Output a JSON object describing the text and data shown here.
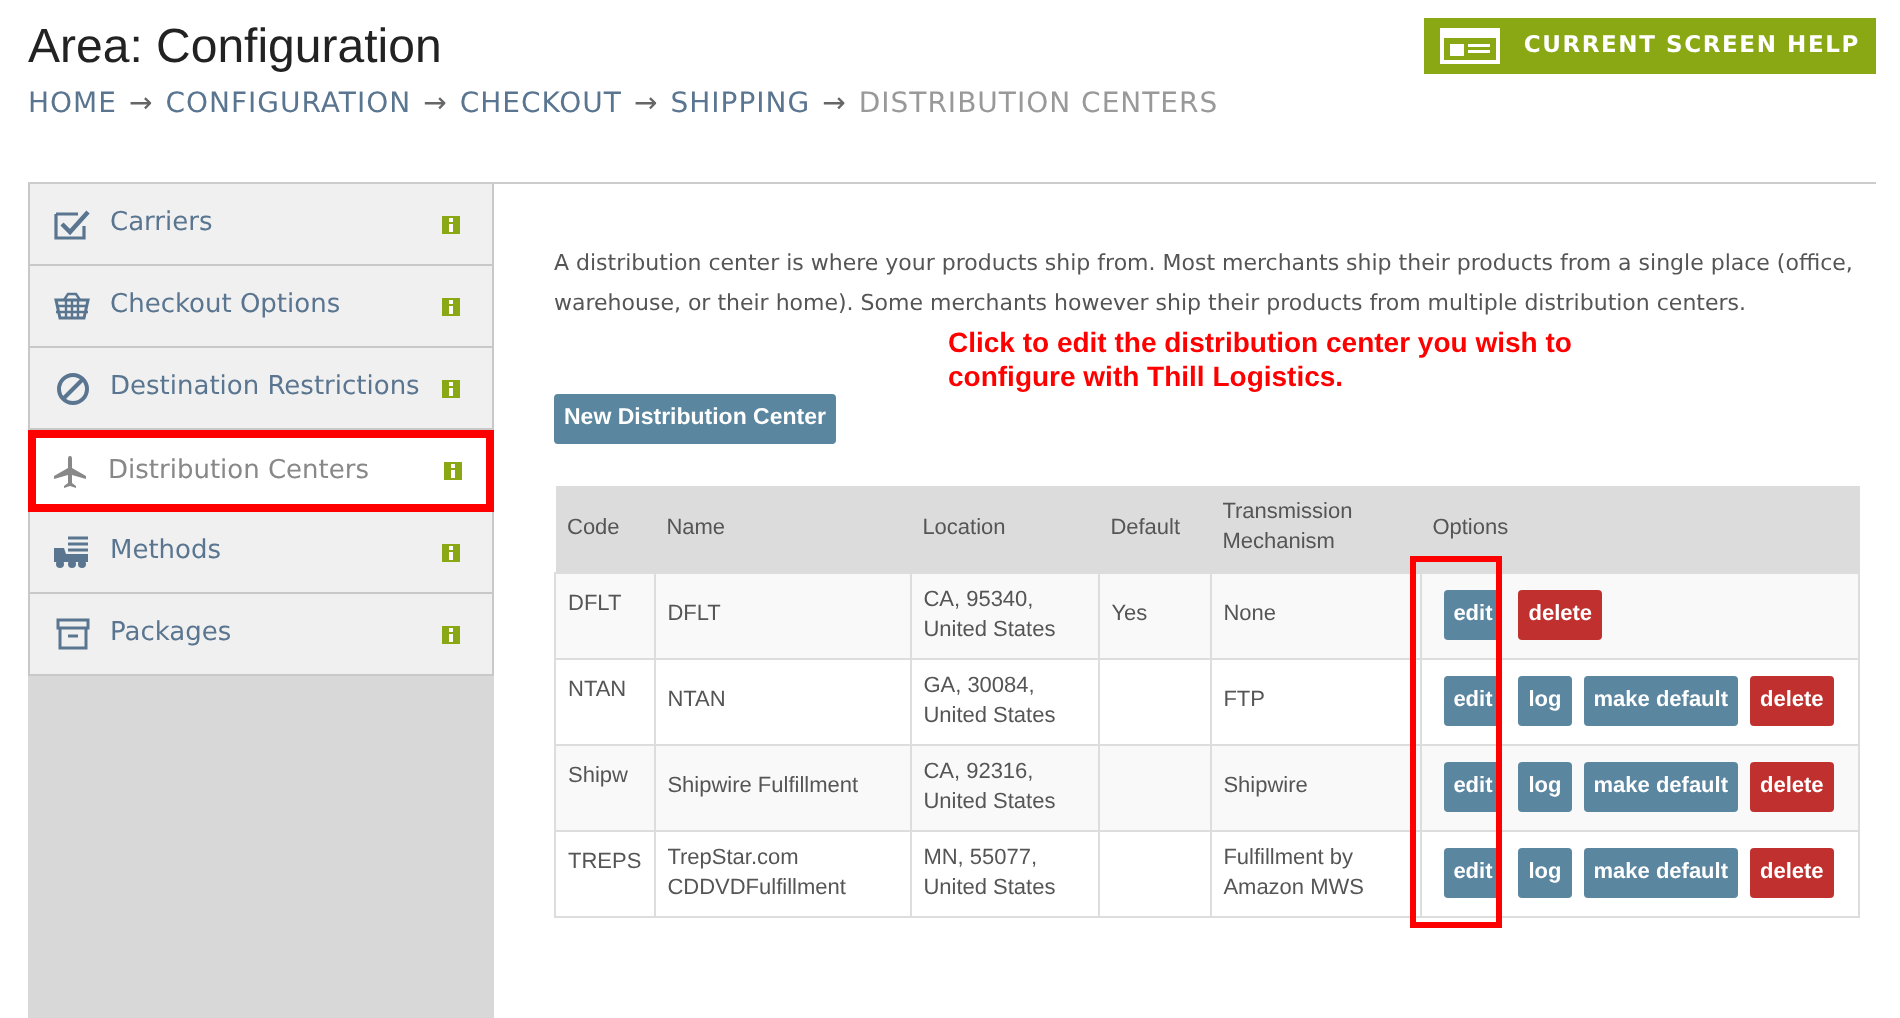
{
  "header": {
    "title": "Area: Configuration",
    "help_button": "CURRENT SCREEN HELP",
    "breadcrumb": [
      {
        "label": "HOME",
        "current": false
      },
      {
        "label": "CONFIGURATION",
        "current": false
      },
      {
        "label": "CHECKOUT",
        "current": false
      },
      {
        "label": "SHIPPING",
        "current": false
      },
      {
        "label": "DISTRIBUTION CENTERS",
        "current": true
      }
    ],
    "separator": "→"
  },
  "sidebar": {
    "items": [
      {
        "label": "Carriers",
        "selected": false
      },
      {
        "label": "Checkout Options",
        "selected": false
      },
      {
        "label": "Destination Restrictions",
        "selected": false
      },
      {
        "label": "Distribution Centers",
        "selected": true
      },
      {
        "label": "Methods",
        "selected": false
      },
      {
        "label": "Packages",
        "selected": false
      }
    ]
  },
  "intro": "A distribution center is where your products ship from. Most merchants ship their products from a single place (office, warehouse, or their home). Some merchants however ship their products from multiple distribution centers.",
  "annotation": "Click to edit the distribution center you wish to configure with Thill Logistics.",
  "new_button": "New Distribution Center",
  "table": {
    "columns": [
      "Code",
      "Name",
      "Location",
      "Default",
      "Transmission Mechanism",
      "Options"
    ],
    "rows": [
      {
        "code": "DFLT",
        "name": "DFLT",
        "location": "CA, 95340, United States",
        "default": "Yes",
        "mechanism": "None",
        "buttons": [
          {
            "label": "edit",
            "kind": "primary"
          },
          {
            "label": "delete",
            "kind": "danger"
          }
        ]
      },
      {
        "code": "NTAN",
        "name": "NTAN",
        "location": "GA, 30084, United States",
        "mechanism": "FTP",
        "buttons": [
          {
            "label": "edit",
            "kind": "primary"
          },
          {
            "label": "log",
            "kind": "primary"
          },
          {
            "label": "make default",
            "kind": "primary"
          },
          {
            "label": "delete",
            "kind": "danger"
          }
        ]
      },
      {
        "code": "Shipw",
        "name": "Shipwire Fulfillment",
        "location": "CA, 92316, United States",
        "mechanism": "Shipwire",
        "buttons": [
          {
            "label": "edit",
            "kind": "primary"
          },
          {
            "label": "log",
            "kind": "primary"
          },
          {
            "label": "make default",
            "kind": "primary"
          },
          {
            "label": "delete",
            "kind": "danger"
          }
        ]
      },
      {
        "code": "TREPS",
        "name": "TrepStar.com CDDVDFulfillment",
        "location": "MN, 55077, United States",
        "mechanism": "Fulfillment by Amazon MWS",
        "buttons": [
          {
            "label": "edit",
            "kind": "primary"
          },
          {
            "label": "log",
            "kind": "primary"
          },
          {
            "label": "make default",
            "kind": "primary"
          },
          {
            "label": "delete",
            "kind": "danger"
          }
        ]
      }
    ]
  }
}
